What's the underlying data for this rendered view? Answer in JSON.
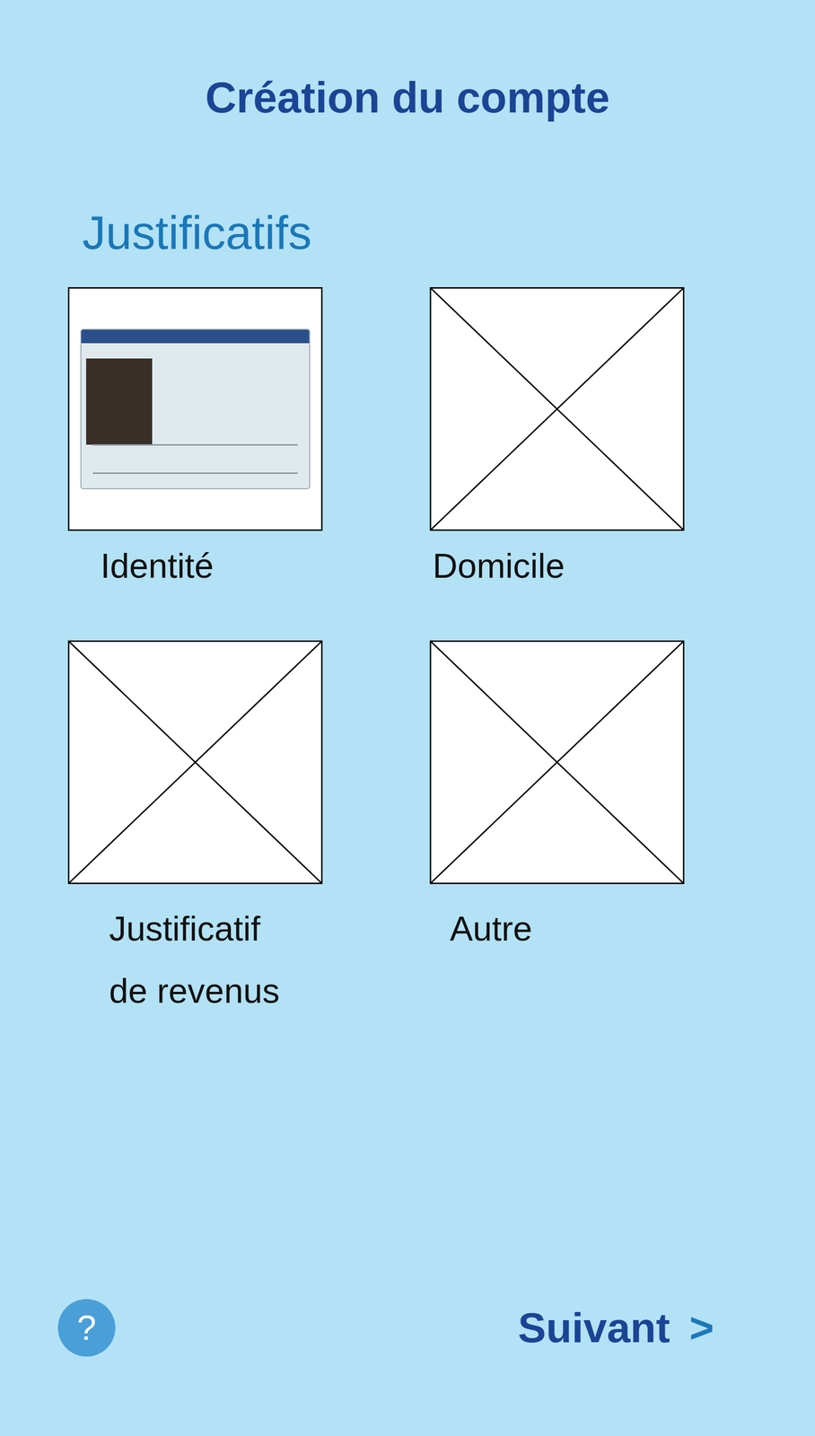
{
  "title": "Création du compte",
  "section": "Justificatifs",
  "documents": [
    {
      "label_lines": [
        "Identité"
      ],
      "kind": "photo"
    },
    {
      "label_lines": [
        "Domicile"
      ],
      "kind": "empty"
    },
    {
      "label_lines": [
        "Justificatif",
        "de revenus"
      ],
      "kind": "empty"
    },
    {
      "label_lines": [
        "Autre"
      ],
      "kind": "empty"
    }
  ],
  "help": "?",
  "next": {
    "label": "Suivant",
    "arrow": ">"
  }
}
